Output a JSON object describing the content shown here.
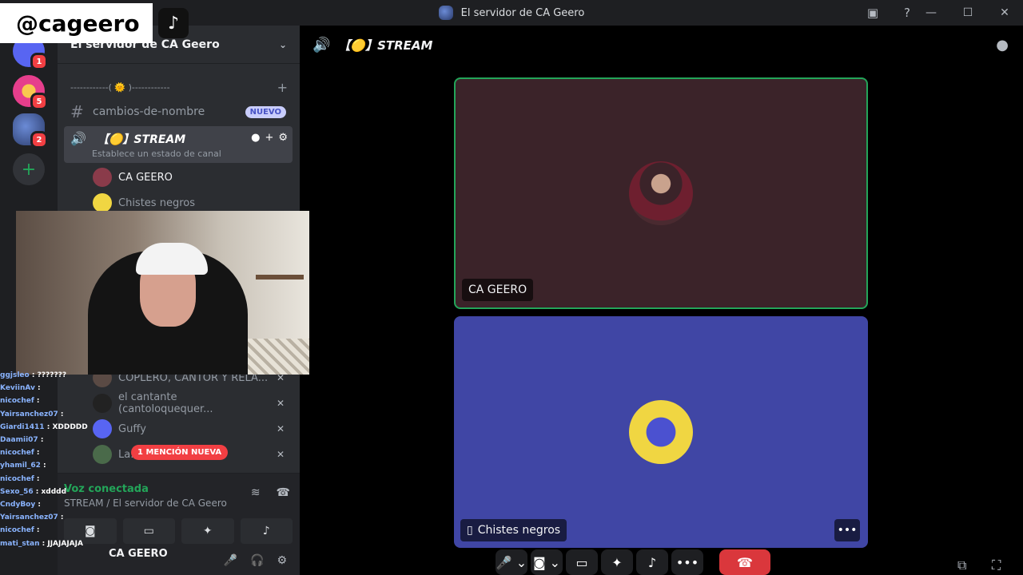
{
  "window": {
    "title": "El servidor de CA Geero"
  },
  "overlay": {
    "handle": "@cageero"
  },
  "guilds": {
    "badges": [
      "1",
      "5",
      "2"
    ]
  },
  "sidebar": {
    "server_name": "El servidor de CA Geero",
    "category": "------------( 🌞 )------------",
    "channels": [
      {
        "name": "cambios-de-nombre",
        "badge": "NUEVO"
      }
    ],
    "voice_channel": {
      "name": "【🟡】STREAM",
      "status": "Establece un estado de canal"
    },
    "voice_users": [
      "CA GEERO",
      "Chistes negros",
      "COPLERO, CANTOR Y RELA...",
      "el cantante (cantoloquequer...",
      "Guffy",
      "La..."
    ],
    "mention": "1 MENCIÓN NUEVA",
    "voice_panel": {
      "status": "Voz conectada",
      "sub": "STREAM / El servidor de CA Geero"
    },
    "user": {
      "name": "CA GEERO"
    }
  },
  "main": {
    "header": "【🟡】STREAM",
    "tiles": [
      {
        "label": "CA GEERO"
      },
      {
        "label": "Chistes negros"
      }
    ]
  },
  "chat_overlay": [
    {
      "nick": "ggjsleo",
      "msg": "???????"
    },
    {
      "nick": "KeviinAv",
      "msg": ""
    },
    {
      "nick": "nicochef",
      "msg": ""
    },
    {
      "nick": "Yairsanchez07",
      "msg": ""
    },
    {
      "nick": "Giardi1411",
      "msg": "XDDDDD"
    },
    {
      "nick": "Daamii07",
      "msg": ""
    },
    {
      "nick": "nicochef",
      "msg": ""
    },
    {
      "nick": "yhamil_62",
      "msg": ""
    },
    {
      "nick": "nicochef",
      "msg": ""
    },
    {
      "nick": "Sexo_56",
      "msg": "xdddd"
    },
    {
      "nick": "CndyBoy",
      "msg": ""
    },
    {
      "nick": "Yairsanchez07",
      "msg": ""
    },
    {
      "nick": "nicochef",
      "msg": ""
    },
    {
      "nick": "mati_stan",
      "msg": "JJAJAJAJA"
    }
  ]
}
